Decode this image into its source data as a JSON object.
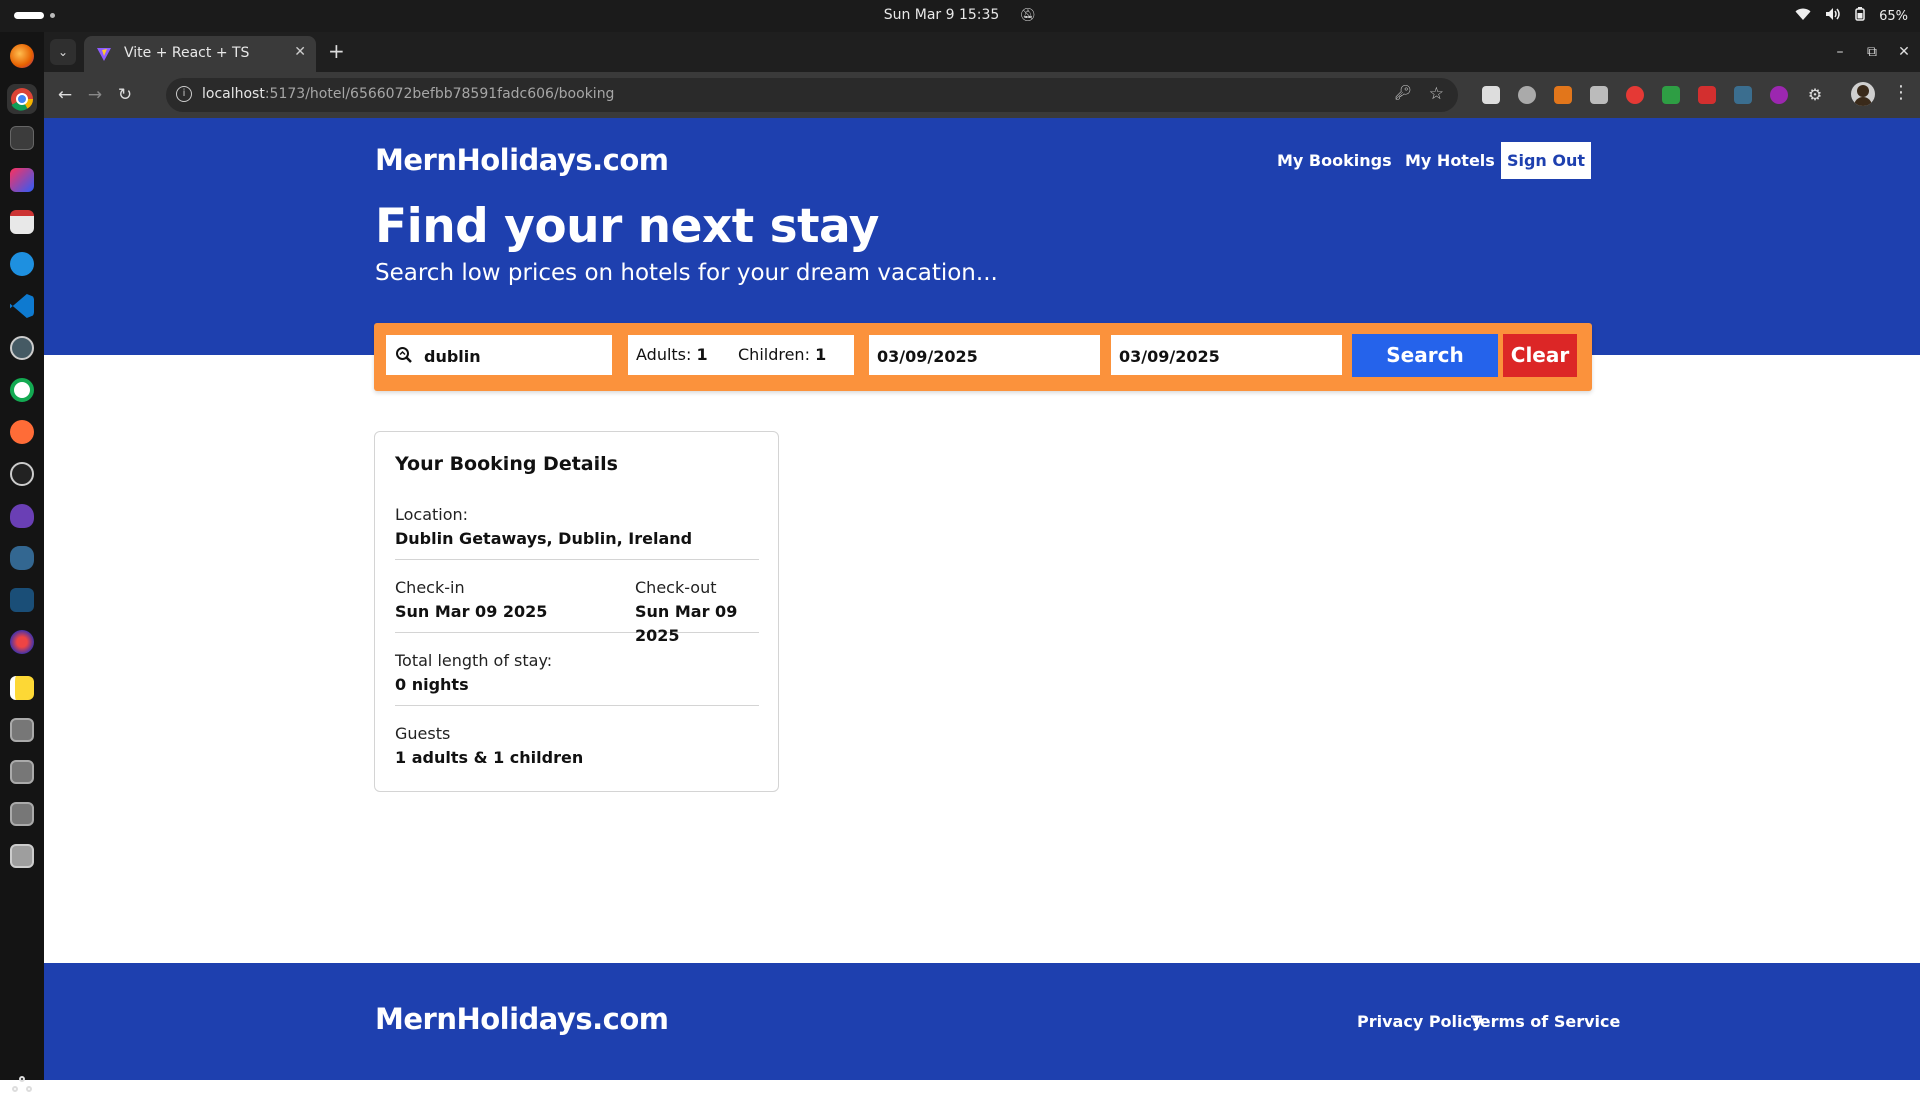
{
  "os": {
    "clock": "Sun Mar 9  15:35",
    "battery": "65%"
  },
  "browser": {
    "tab_title": "Vite + React + TS",
    "url_host": "localhost",
    "url_path": ":5173/hotel/6566072befbb78591fadc606/booking"
  },
  "header": {
    "brand": "MernHolidays.com",
    "my_bookings": "My Bookings",
    "my_hotels": "My Hotels",
    "sign_out": "Sign Out"
  },
  "hero": {
    "title": "Find your next stay",
    "subtitle": "Search low prices on hotels for your dream vacation..."
  },
  "search": {
    "destination": "dublin",
    "adults_label": "Adults:",
    "adults_value": "1",
    "children_label": "Children:",
    "children_value": "1",
    "check_in": "03/09/2025",
    "check_out": "03/09/2025",
    "search_label": "Search",
    "clear_label": "Clear"
  },
  "booking": {
    "title": "Your Booking Details",
    "location_label": "Location:",
    "location_value": "Dublin Getaways, Dublin, Ireland",
    "checkin_label": "Check-in",
    "checkin_value": "Sun Mar 09 2025",
    "checkout_label": "Check-out",
    "checkout_value": "Sun Mar 09 2025",
    "stay_label": "Total length of stay:",
    "stay_value": "0 nights",
    "guests_label": "Guests",
    "guests_value": "1 adults & 1 children"
  },
  "footer": {
    "brand": "MernHolidays.com",
    "privacy": "Privacy Policy",
    "terms": "Terms of Service"
  },
  "colors": {
    "brand_blue": "#1e40af",
    "search_orange": "#fb923c",
    "search_button": "#2563eb",
    "clear_button": "#dc2626"
  }
}
